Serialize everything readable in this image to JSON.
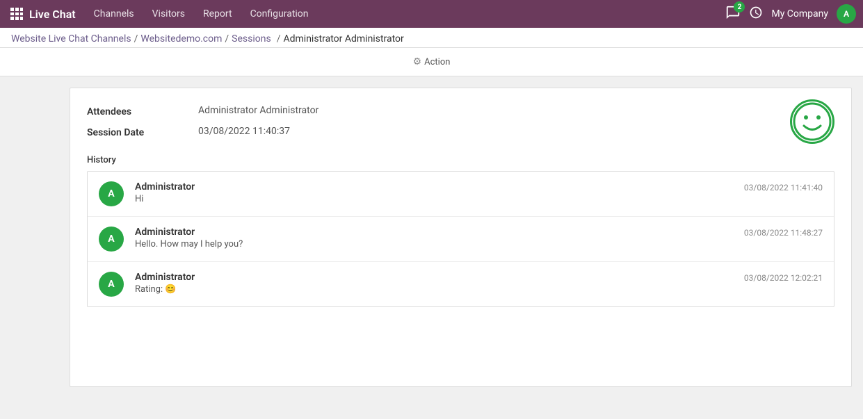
{
  "app": {
    "title": "Live Chat"
  },
  "topbar": {
    "nav_items": [
      "Channels",
      "Visitors",
      "Report",
      "Configuration"
    ],
    "badge_count": "2",
    "company": "My Company",
    "user_initial": "A"
  },
  "breadcrumb": {
    "items": [
      {
        "label": "Website Live Chat Channels",
        "link": true
      },
      {
        "label": "Websitedemo.com",
        "link": true
      },
      {
        "label": "Sessions",
        "link": true
      },
      {
        "label": "Administrator Administrator",
        "link": false
      }
    ],
    "separators": [
      "/",
      "/",
      "/"
    ]
  },
  "action": {
    "label": "Action",
    "gear": "⚙"
  },
  "form": {
    "attendees_label": "Attendees",
    "attendees_value": "Administrator Administrator",
    "session_date_label": "Session Date",
    "session_date_value": "03/08/2022 11:40:37"
  },
  "history": {
    "label": "History",
    "rows": [
      {
        "avatar": "A",
        "name": "Administrator",
        "message": "Hi",
        "timestamp": "03/08/2022 11:41:40"
      },
      {
        "avatar": "A",
        "name": "Administrator",
        "message": "Hello. How may I help you?",
        "timestamp": "03/08/2022 11:48:27"
      },
      {
        "avatar": "A",
        "name": "Administrator",
        "message": "Rating: 😊",
        "timestamp": "03/08/2022 12:02:21"
      }
    ]
  }
}
